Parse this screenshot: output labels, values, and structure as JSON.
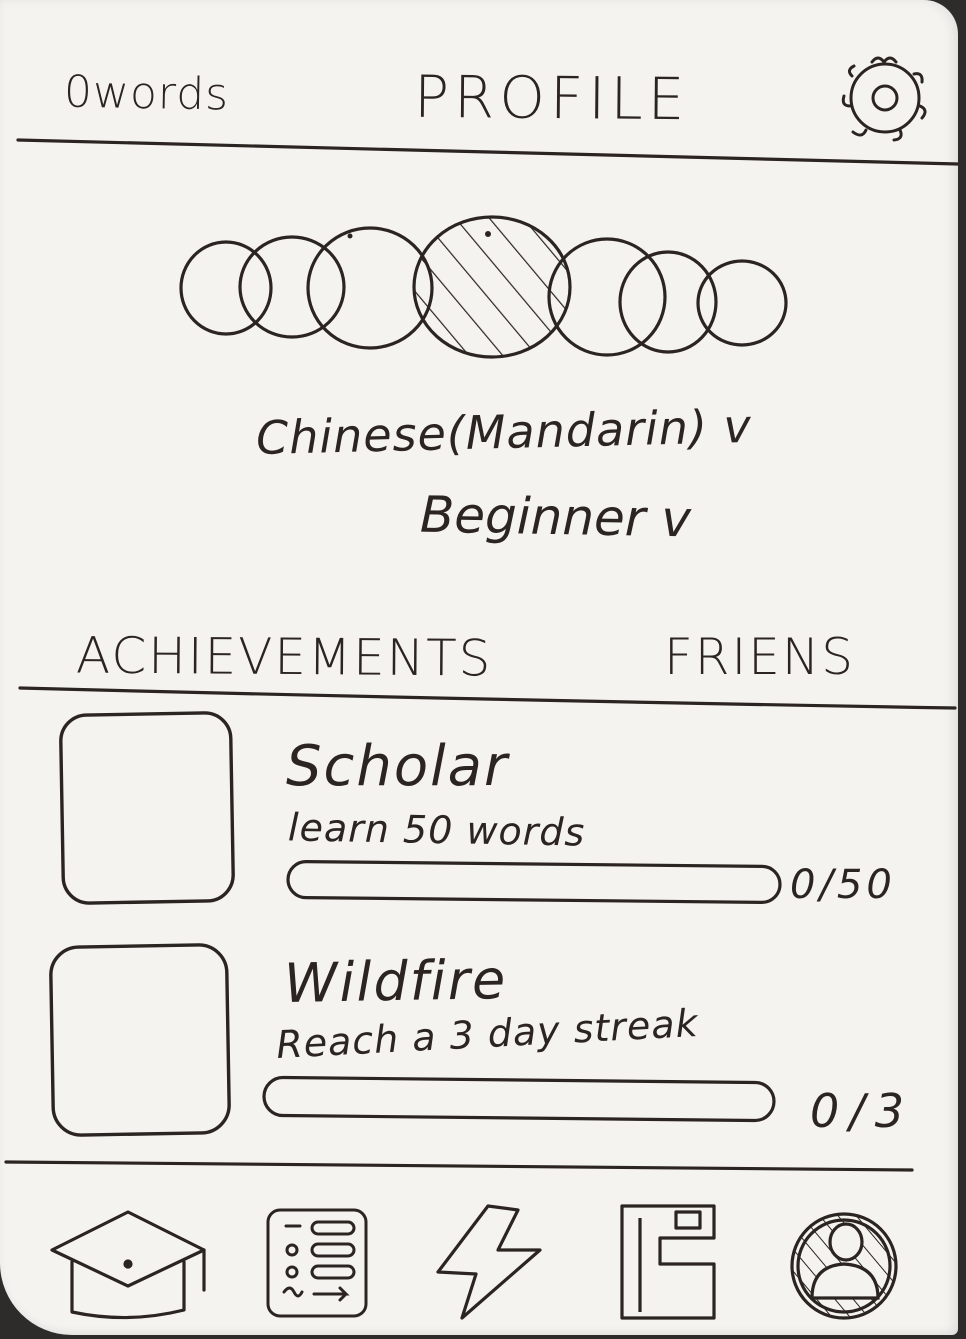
{
  "header": {
    "word_count": "0words",
    "title": "PROFILE",
    "settings_icon": "gear-icon"
  },
  "profile": {
    "language_selected": "Chinese(Mandarin) v",
    "level_selected": "Beginner v"
  },
  "tabs": {
    "achievements_label": "ACHIEVEMENTS",
    "friends_label": "FRIENS"
  },
  "achievements": [
    {
      "title": "Scholar",
      "description": "learn 50 words",
      "count": "0/50",
      "progress": 0
    },
    {
      "title": "Wildfire",
      "description": "Reach a 3 day streak",
      "count": "0/3",
      "progress": 0
    }
  ],
  "bottom_nav": [
    {
      "icon": "graduation-cap-icon"
    },
    {
      "icon": "list-icon"
    },
    {
      "icon": "lightning-bolt-icon"
    },
    {
      "icon": "flashcard-icon"
    },
    {
      "icon": "profile-person-icon",
      "active": true
    }
  ],
  "colors": {
    "paper": "#f4f3ef",
    "ink": "#2b2420",
    "background": "#2e2c2a"
  }
}
